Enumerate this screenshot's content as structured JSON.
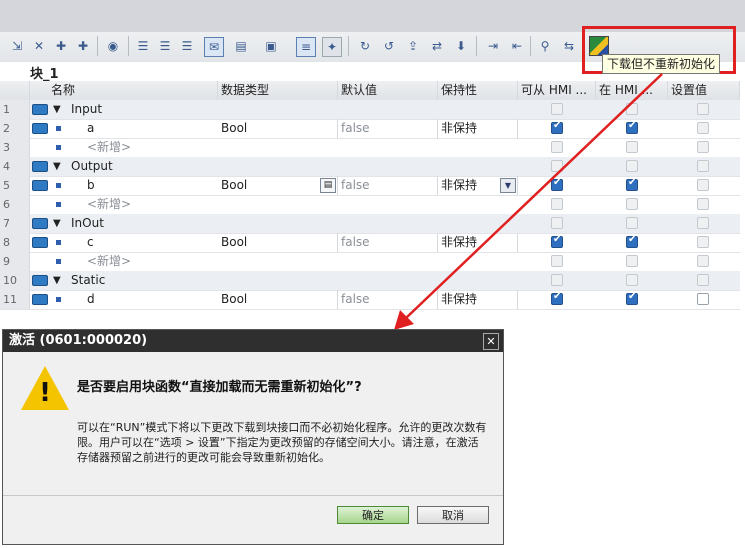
{
  "tooltip": "下载但不重新初始化",
  "block_name": "块_1",
  "columns": [
    "",
    "名称",
    "数据类型",
    "默认值",
    "保持性",
    "可从 HMI ...",
    "在 HMI ...",
    "设置值"
  ],
  "rows": [
    {
      "n": "1",
      "name": "Input",
      "type": "",
      "def": "",
      "ret": "",
      "group": true
    },
    {
      "n": "2",
      "name": "a",
      "type": "Bool",
      "def": "false",
      "ret": "非保持"
    },
    {
      "n": "3",
      "name": "<新增>",
      "type": "",
      "def": "",
      "ret": "",
      "placeholder": true
    },
    {
      "n": "4",
      "name": "Output",
      "type": "",
      "def": "",
      "ret": "",
      "group": true
    },
    {
      "n": "5",
      "name": "b",
      "type": "Bool",
      "def": "false",
      "ret": "非保持"
    },
    {
      "n": "6",
      "name": "<新增>",
      "type": "",
      "def": "",
      "ret": "",
      "placeholder": true
    },
    {
      "n": "7",
      "name": "InOut",
      "type": "",
      "def": "",
      "ret": "",
      "group": true
    },
    {
      "n": "8",
      "name": "c",
      "type": "Bool",
      "def": "false",
      "ret": "非保持"
    },
    {
      "n": "9",
      "name": "<新增>",
      "type": "",
      "def": "",
      "ret": "",
      "placeholder": true
    },
    {
      "n": "10",
      "name": "Static",
      "type": "",
      "def": "",
      "ret": "",
      "group": true
    },
    {
      "n": "11",
      "name": "d",
      "type": "Bool",
      "def": "false",
      "ret": "非保持"
    }
  ],
  "dialog": {
    "title": "激活 (0601:000020)",
    "question": "是否要启用块函数“直接加载而无需重新初始化”?",
    "message": "可以在“RUN”模式下将以下更改下载到块接口而不必初始化程序。允许的更改次数有限。用户可以在“选项 > 设置”下指定为更改预留的存储空间大小。请注意，在激活存储器预留之前进行的更改可能会导致重新初始化。",
    "ok": "确定",
    "cancel": "取消"
  },
  "colors": {
    "highlight": "#e02020",
    "tooltip_bg": "#ffffe1",
    "ok_button": "#a6d58d"
  }
}
